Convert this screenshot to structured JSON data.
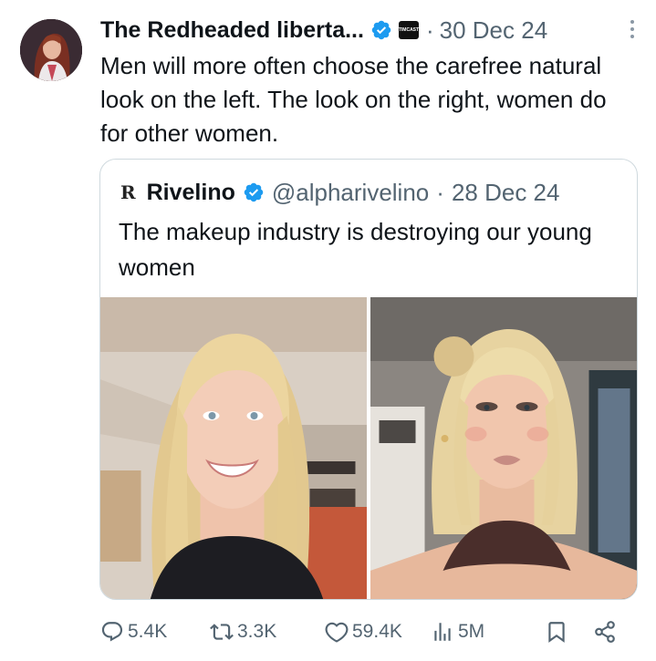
{
  "post": {
    "author_name": "The Redheaded liberta...",
    "affiliation_badge": "TIMCAST",
    "separator": "·",
    "date": "30 Dec 24",
    "text": "Men will more often choose the carefree natural look on the left. The look on the right, women do for other women."
  },
  "quote": {
    "logo": "R",
    "author_name": "Rivelino",
    "handle": "@alpharivelino",
    "separator": "·",
    "date": "28 Dec 24",
    "text": "The makeup industry is destroying our young women"
  },
  "actions": {
    "replies": "5.4K",
    "reposts": "3.3K",
    "likes": "59.4K",
    "views": "5M"
  },
  "icons": [
    "verified-badge-icon",
    "more-icon",
    "reply-icon",
    "repost-icon",
    "like-icon",
    "views-icon",
    "bookmark-icon",
    "share-icon"
  ],
  "colors": {
    "verified": "#1d9bf0",
    "text": "#0f1419",
    "muted": "#536471",
    "border": "#cfd9de"
  }
}
